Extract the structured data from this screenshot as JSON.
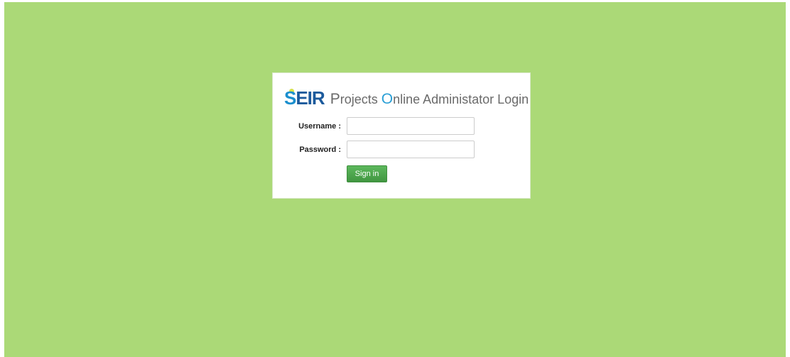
{
  "colors": {
    "page_background": "#abd977",
    "card_background": "#ffffff",
    "logo_primary": "#1c5a9c",
    "logo_accent": "#1b8fce",
    "title_accent": "#2a9fd6",
    "button": "#4cae4c"
  },
  "logo": {
    "s": "S",
    "rest": "EIR"
  },
  "title": {
    "p_initial": "P",
    "p_rest": "rojects ",
    "o_initial": "O",
    "o_rest": "nline Administator Login"
  },
  "form": {
    "username_label": "Username :",
    "username_value": "",
    "password_label": "Password :",
    "password_value": "",
    "signin_label": "Sign in"
  }
}
